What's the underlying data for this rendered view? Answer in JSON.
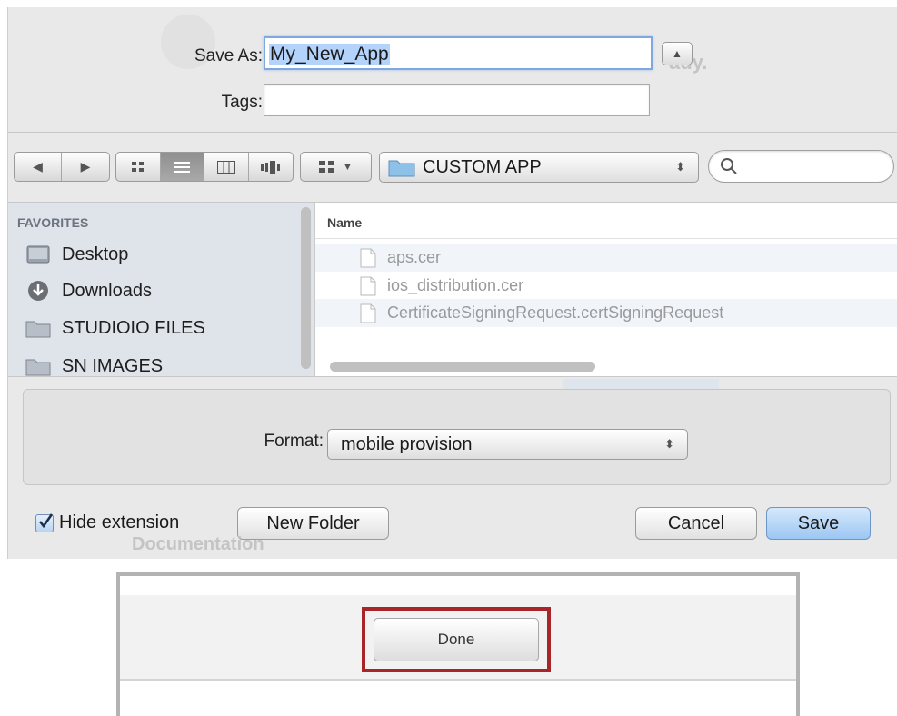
{
  "save_dialog": {
    "save_as_label": "Save As:",
    "save_as_value": "My_New_App",
    "tags_label": "Tags:",
    "tags_value": "",
    "background_ghost_texts": [
      "ady.",
      "Documentation"
    ],
    "toolbar": {
      "location_popup": "CUSTOM APP",
      "search_placeholder": ""
    },
    "sidebar": {
      "heading": "FAVORITES",
      "items": [
        {
          "label": "Desktop",
          "icon": "desktop-icon"
        },
        {
          "label": "Downloads",
          "icon": "downloads-icon"
        },
        {
          "label": "STUDIOIO FILES",
          "icon": "folder-icon"
        },
        {
          "label": "SN IMAGES",
          "icon": "folder-icon"
        }
      ]
    },
    "file_list": {
      "column_header": "Name",
      "files": [
        {
          "name": "aps.cer",
          "icon": "document-icon"
        },
        {
          "name": "ios_distribution.cer",
          "icon": "document-icon"
        },
        {
          "name": "CertificateSigningRequest.certSigningRequest",
          "icon": "document-icon"
        }
      ]
    },
    "format_label": "Format:",
    "format_value": "mobile provision",
    "hide_extension_label": "Hide extension",
    "hide_extension_checked": true,
    "new_folder_label": "New Folder",
    "cancel_label": "Cancel",
    "save_label": "Save"
  },
  "done_panel": {
    "done_label": "Done",
    "highlight_color": "#a8252a"
  },
  "colors": {
    "accent": "#9cc7f3",
    "selection": "#b4d3fb",
    "sidebar_bg": "#dfe3ea"
  }
}
